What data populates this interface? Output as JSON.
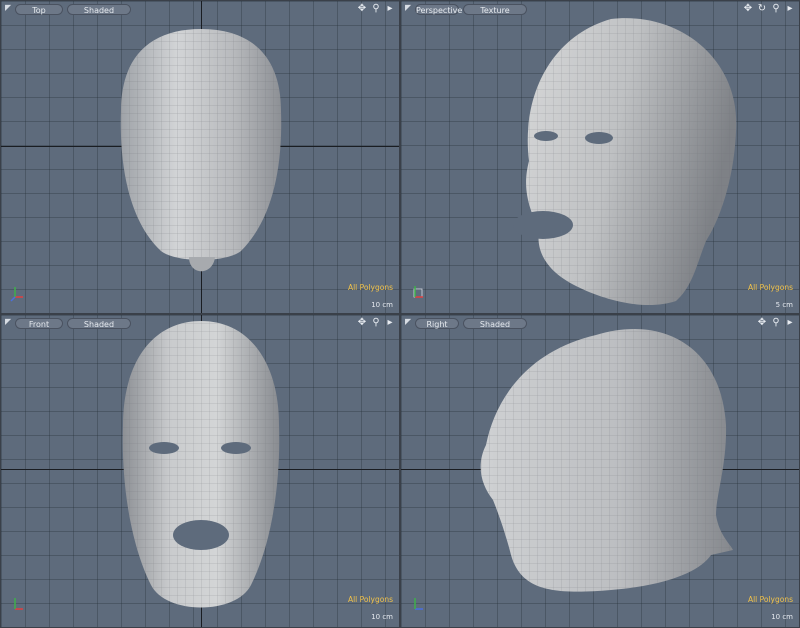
{
  "viewports": [
    {
      "view_label": "Top",
      "shading_label": "Shaded",
      "status": "All Polygons",
      "scale": "10 cm"
    },
    {
      "view_label": "Perspective",
      "shading_label": "Texture",
      "status": "All Polygons",
      "scale": "5 cm"
    },
    {
      "view_label": "Front",
      "shading_label": "Shaded",
      "status": "All Polygons",
      "scale": "10 cm"
    },
    {
      "view_label": "Right",
      "shading_label": "Shaded",
      "status": "All Polygons",
      "scale": "10 cm"
    }
  ],
  "icons": {
    "menu": "triangle-menu-icon",
    "move": "pan-move-icon",
    "zoom": "zoom-magnifier-icon",
    "rotate": "rotate-view-icon",
    "more": "more-arrow-icon"
  },
  "colors": {
    "viewport_bg": "#5e6b7c",
    "status_text": "#f1c24a"
  }
}
